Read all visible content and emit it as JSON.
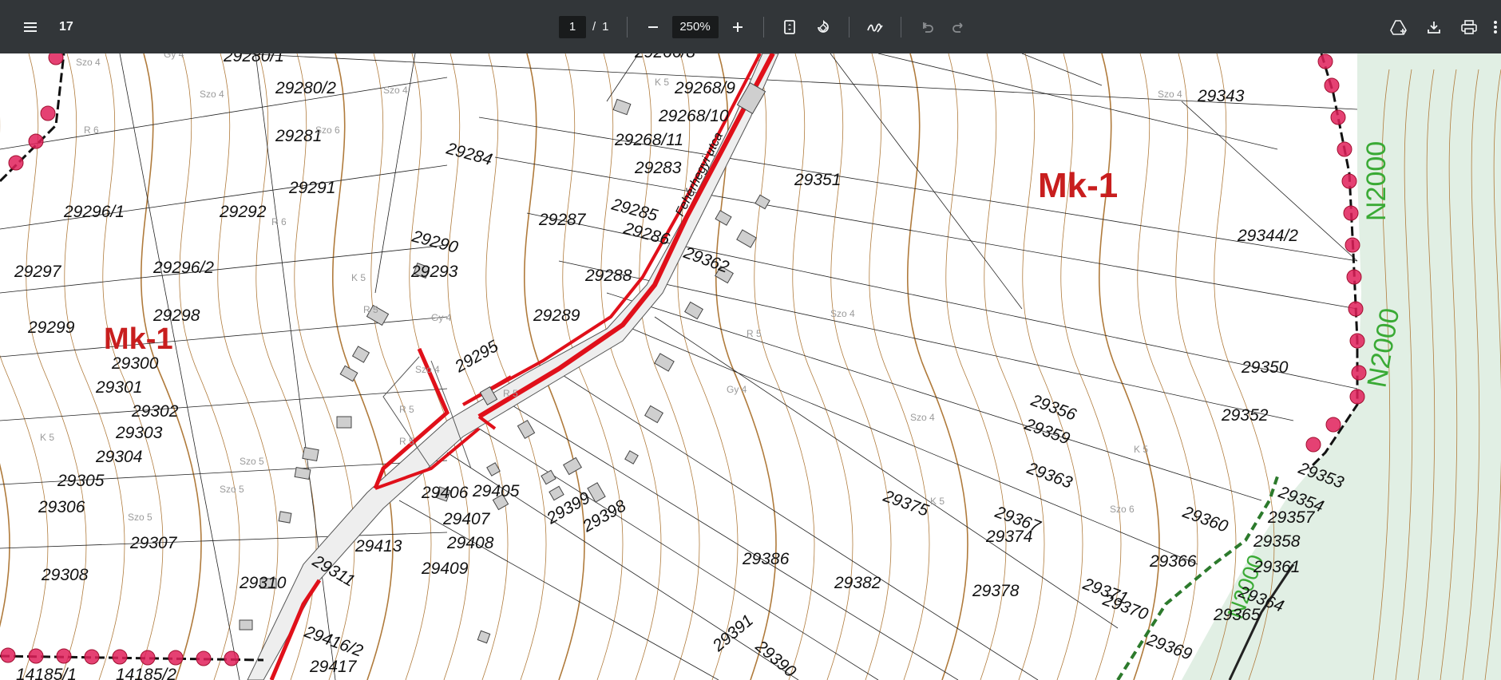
{
  "toolbar": {
    "title": "17",
    "page_current": "1",
    "page_separator": "/",
    "page_total": "1",
    "zoom": "250%"
  },
  "icons": {
    "menu": "menu-icon",
    "zoom_out": "minus-icon",
    "zoom_in": "plus-icon",
    "fit": "fit-page-icon",
    "rotate": "rotate-icon",
    "draw": "annotate-icon",
    "undo": "undo-icon",
    "redo": "redo-icon",
    "drive": "add-to-drive-icon",
    "download": "download-icon",
    "print": "print-icon",
    "more": "more-vert-icon"
  },
  "map": {
    "zone_labels": [
      "Mk-1",
      "Mk-1"
    ],
    "natura_labels": [
      "N2000",
      "N2000",
      "N2000"
    ],
    "street_name": "Fehérhegyi utca",
    "parcels": [
      "29280/1",
      "29280/2",
      "29281",
      "29268/9",
      "29268/10",
      "29268/11",
      "29283",
      "29284",
      "29291",
      "29292",
      "29296/1",
      "29285",
      "29286",
      "29287",
      "29290",
      "29296/2",
      "29297",
      "29293",
      "29288",
      "29298",
      "29289",
      "29299",
      "29300",
      "29295",
      "29301",
      "29302",
      "29303",
      "29304",
      "29305",
      "29306",
      "29307",
      "29308",
      "29310",
      "29311",
      "29406",
      "29405",
      "29407",
      "29408",
      "29413",
      "29409",
      "29399",
      "29398",
      "29351",
      "29343",
      "29344/2",
      "29362",
      "29350",
      "29356",
      "29359",
      "29363",
      "29352",
      "29353",
      "29354",
      "29357",
      "29358",
      "29375",
      "29367",
      "29374",
      "29360",
      "29361",
      "29366",
      "29364",
      "29365",
      "29378",
      "29382",
      "29386",
      "29390",
      "29391",
      "29371",
      "29370",
      "29369",
      "14185/1",
      "14185/2",
      "29266/8",
      "29416/2",
      "29417"
    ],
    "land_use_codes": [
      "Szo 4",
      "Szo 4",
      "Szo 4",
      "Szo 4",
      "Szo 4",
      "K 5",
      "R 6",
      "R 6",
      "K 5",
      "Gy 4",
      "Gy 4",
      "R 5",
      "R 5",
      "K 5",
      "Szo 5",
      "Szo 5",
      "Szo 5",
      "Szo 6",
      "R 5",
      "K 5",
      "Szo 4",
      "Szo 4",
      "Gy 4",
      "R 5",
      "Szo 6",
      "K 5",
      "R 5"
    ]
  },
  "colors": {
    "toolbar_bg": "#323639",
    "contour": "#b07b3c",
    "red_road": "#e0101a",
    "zone_red": "#c81e1e",
    "natura_green": "#3aaa35",
    "natura_fill": "#e1efe4"
  }
}
